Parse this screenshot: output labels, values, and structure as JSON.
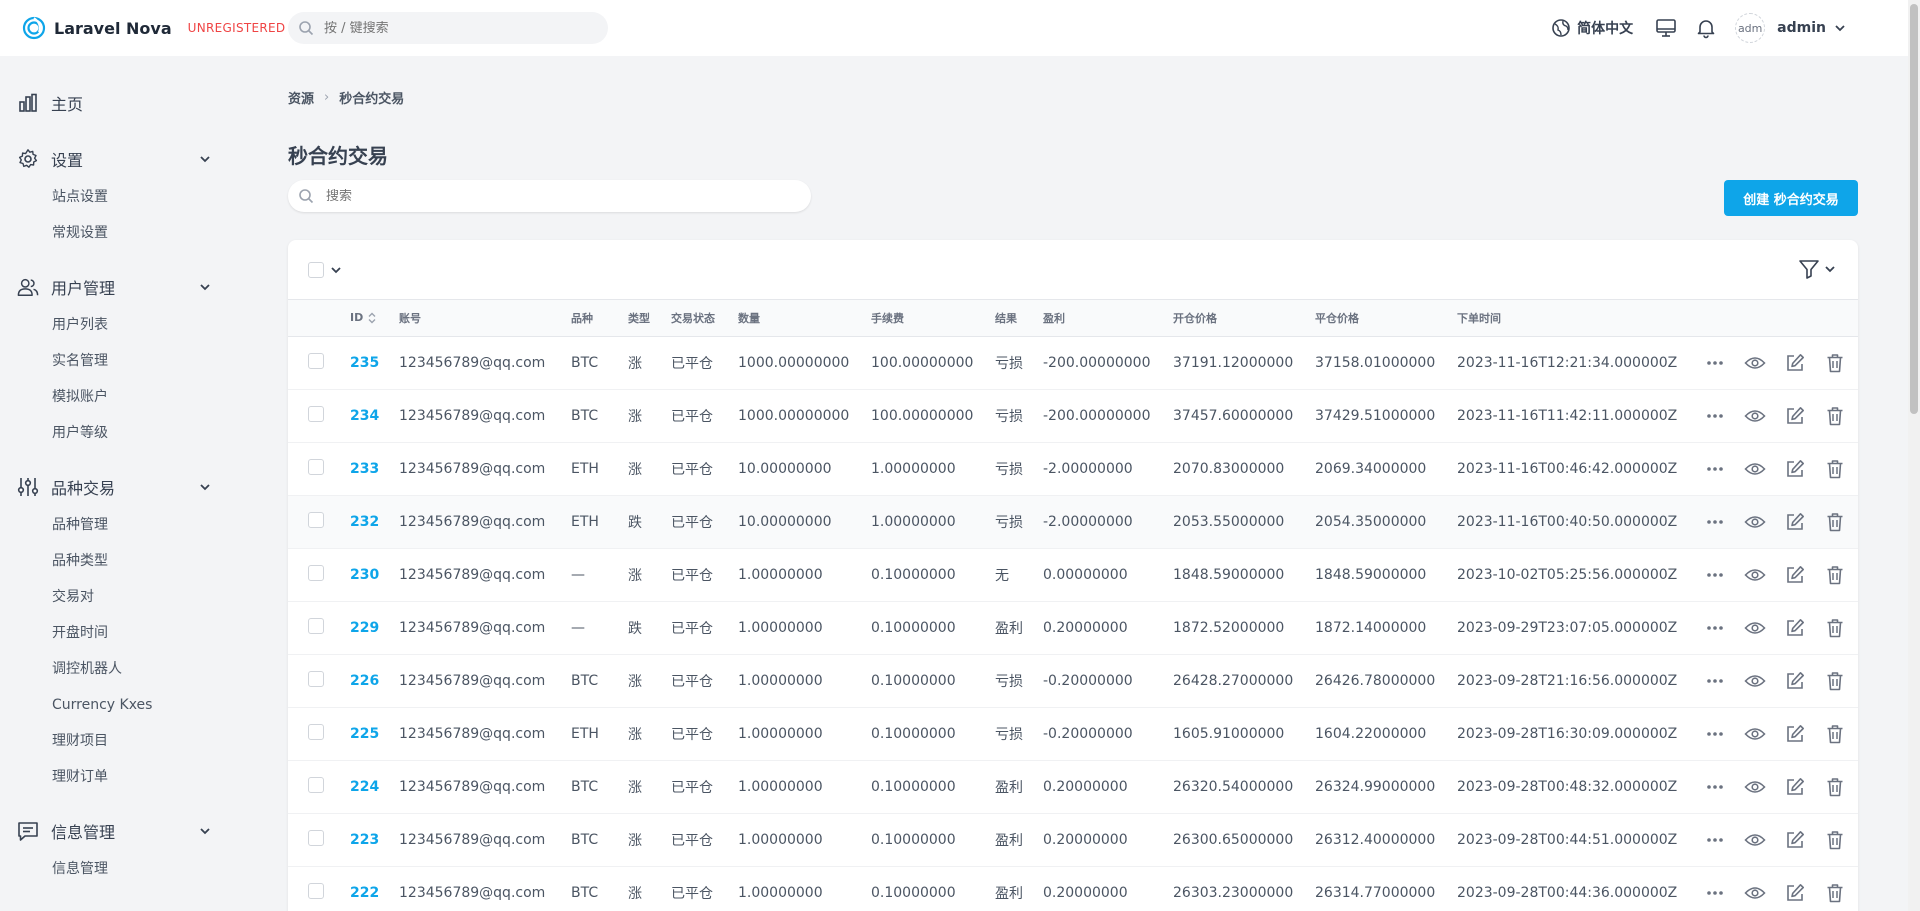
{
  "app": {
    "name": "Laravel Nova",
    "badge": "UNREGISTERED",
    "search_placeholder": "按 / 键搜索",
    "language": "简体中文",
    "user": "admin",
    "avatar_alt": "adm"
  },
  "sidebar": {
    "home": "主页",
    "groups": [
      {
        "label": "设置",
        "icon": "gear-icon",
        "items": [
          "站点设置",
          "常规设置"
        ]
      },
      {
        "label": "用户管理",
        "icon": "users-icon",
        "items": [
          "用户列表",
          "实名管理",
          "模拟账户",
          "用户等级"
        ]
      },
      {
        "label": "品种交易",
        "icon": "sliders-icon",
        "items": [
          "品种管理",
          "品种类型",
          "交易对",
          "开盘时间",
          "调控机器人",
          "Currency Kxes",
          "理财项目",
          "理财订单"
        ]
      },
      {
        "label": "信息管理",
        "icon": "message-icon",
        "items": [
          "信息管理"
        ]
      }
    ]
  },
  "breadcrumb": {
    "root": "资源",
    "current": "秒合约交易"
  },
  "page": {
    "title": "秒合约交易",
    "search_placeholder": "搜索",
    "create_label": "创建 秒合约交易"
  },
  "table": {
    "columns": [
      "ID",
      "账号",
      "品种",
      "类型",
      "交易状态",
      "数量",
      "手续费",
      "结果",
      "盈利",
      "开仓价格",
      "平仓价格",
      "下单时间"
    ],
    "rows": [
      [
        "235",
        "123456789@qq.com",
        "BTC",
        "涨",
        "已平仓",
        "1000.00000000",
        "100.00000000",
        "亏损",
        "-200.00000000",
        "37191.12000000",
        "37158.01000000",
        "2023-11-16T12:21:34.000000Z"
      ],
      [
        "234",
        "123456789@qq.com",
        "BTC",
        "涨",
        "已平仓",
        "1000.00000000",
        "100.00000000",
        "亏损",
        "-200.00000000",
        "37457.60000000",
        "37429.51000000",
        "2023-11-16T11:42:11.000000Z"
      ],
      [
        "233",
        "123456789@qq.com",
        "ETH",
        "涨",
        "已平仓",
        "10.00000000",
        "1.00000000",
        "亏损",
        "-2.00000000",
        "2070.83000000",
        "2069.34000000",
        "2023-11-16T00:46:42.000000Z"
      ],
      [
        "232",
        "123456789@qq.com",
        "ETH",
        "跌",
        "已平仓",
        "10.00000000",
        "1.00000000",
        "亏损",
        "-2.00000000",
        "2053.55000000",
        "2054.35000000",
        "2023-11-16T00:40:50.000000Z"
      ],
      [
        "230",
        "123456789@qq.com",
        "—",
        "涨",
        "已平仓",
        "1.00000000",
        "0.10000000",
        "无",
        "0.00000000",
        "1848.59000000",
        "1848.59000000",
        "2023-10-02T05:25:56.000000Z"
      ],
      [
        "229",
        "123456789@qq.com",
        "—",
        "跌",
        "已平仓",
        "1.00000000",
        "0.10000000",
        "盈利",
        "0.20000000",
        "1872.52000000",
        "1872.14000000",
        "2023-09-29T23:07:05.000000Z"
      ],
      [
        "226",
        "123456789@qq.com",
        "BTC",
        "涨",
        "已平仓",
        "1.00000000",
        "0.10000000",
        "亏损",
        "-0.20000000",
        "26428.27000000",
        "26426.78000000",
        "2023-09-28T21:16:56.000000Z"
      ],
      [
        "225",
        "123456789@qq.com",
        "ETH",
        "涨",
        "已平仓",
        "1.00000000",
        "0.10000000",
        "亏损",
        "-0.20000000",
        "1605.91000000",
        "1604.22000000",
        "2023-09-28T16:30:09.000000Z"
      ],
      [
        "224",
        "123456789@qq.com",
        "BTC",
        "涨",
        "已平仓",
        "1.00000000",
        "0.10000000",
        "盈利",
        "0.20000000",
        "26320.54000000",
        "26324.99000000",
        "2023-09-28T00:48:32.000000Z"
      ],
      [
        "223",
        "123456789@qq.com",
        "BTC",
        "涨",
        "已平仓",
        "1.00000000",
        "0.10000000",
        "盈利",
        "0.20000000",
        "26300.65000000",
        "26312.40000000",
        "2023-09-28T00:44:51.000000Z"
      ],
      [
        "222",
        "123456789@qq.com",
        "BTC",
        "涨",
        "已平仓",
        "1.00000000",
        "0.10000000",
        "盈利",
        "0.20000000",
        "26303.23000000",
        "26314.77000000",
        "2023-09-28T00:44:36.000000Z"
      ]
    ]
  },
  "colors": {
    "accent": "#0ea5e9",
    "badge": "#ef4444"
  }
}
